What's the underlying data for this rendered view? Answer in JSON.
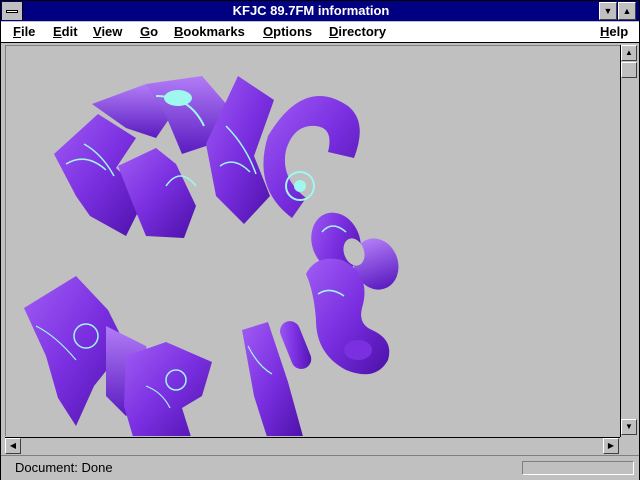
{
  "window": {
    "title": "KFJC 89.7FM information"
  },
  "menu": {
    "items": [
      "File",
      "Edit",
      "View",
      "Go",
      "Bookmarks",
      "Options",
      "Directory",
      "Help"
    ]
  },
  "status": {
    "text": "Document: Done",
    "progress_fraction": 0
  },
  "icons": {
    "system_menu": "system-menu-icon",
    "minimize": "triangle-down",
    "maximize": "triangle-up",
    "scroll_up": "arrow-up",
    "scroll_down": "arrow-down",
    "scroll_left": "arrow-left",
    "scroll_right": "arrow-right"
  },
  "colors": {
    "titlebar": "#000080",
    "page_background": "#c0c0c0",
    "logo_purple": "#7a2fe0",
    "logo_cyan": "#9ff7f0"
  }
}
